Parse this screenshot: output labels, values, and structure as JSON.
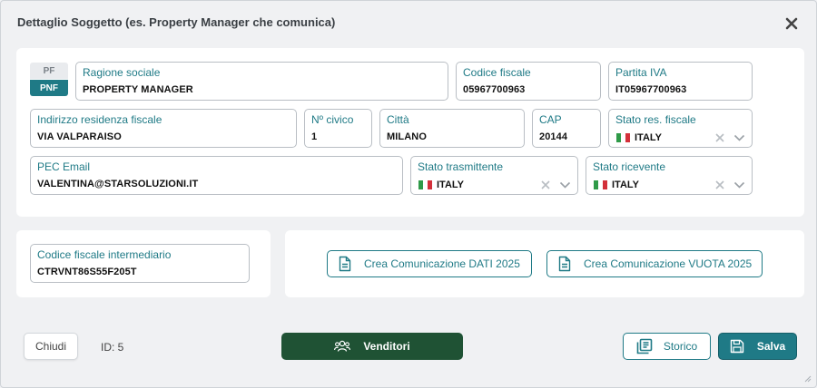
{
  "modal": {
    "title": "Dettaglio Soggetto (es. Property Manager che comunica)"
  },
  "subject_type": {
    "options": [
      "PF",
      "PNF"
    ],
    "selected": "PNF"
  },
  "fields": {
    "ragione_sociale": {
      "label": "Ragione sociale",
      "value": "PROPERTY MANAGER"
    },
    "codice_fiscale": {
      "label": "Codice fiscale",
      "value": "05967700963"
    },
    "partita_iva": {
      "label": "Partita IVA",
      "value": "IT05967700963"
    },
    "indirizzo": {
      "label": "Indirizzo residenza fiscale",
      "value": "VIA VALPARAISO"
    },
    "civico": {
      "label": "Nº civico",
      "value": "1"
    },
    "citta": {
      "label": "Città",
      "value": "MILANO"
    },
    "cap": {
      "label": "CAP",
      "value": "20144"
    },
    "stato_res": {
      "label": "Stato res. fiscale",
      "value": "ITALY"
    },
    "pec": {
      "label": "PEC Email",
      "value": "VALENTINA@STARSOLUZIONI.IT"
    },
    "stato_trasmittente": {
      "label": "Stato trasmittente",
      "value": "ITALY"
    },
    "stato_ricevente": {
      "label": "Stato ricevente",
      "value": "ITALY"
    },
    "cf_intermediario": {
      "label": "Codice fiscale intermediario",
      "value": "CTRVNT86S55F205T"
    }
  },
  "actions": {
    "crea_dati": "Crea Comunicazione DATI 2025",
    "crea_vuota": "Crea Comunicazione VUOTA 2025"
  },
  "footer": {
    "chiudi": "Chiudi",
    "id": "ID: 5",
    "venditori": "Venditori",
    "storico": "Storico",
    "salva": "Salva"
  },
  "colors": {
    "accent": "#1f7a86",
    "venditori_bg": "#1f5234",
    "flag_green": "#2f9a48",
    "flag_white": "#ffffff",
    "flag_red": "#d3303a"
  },
  "icons": {
    "close": "close-icon",
    "clear": "clear-x-icon",
    "chevron": "chevron-down-icon",
    "document": "document-icon",
    "users": "users-icon",
    "history": "history-icon",
    "save": "save-icon",
    "resize": "resize-handle-icon"
  }
}
